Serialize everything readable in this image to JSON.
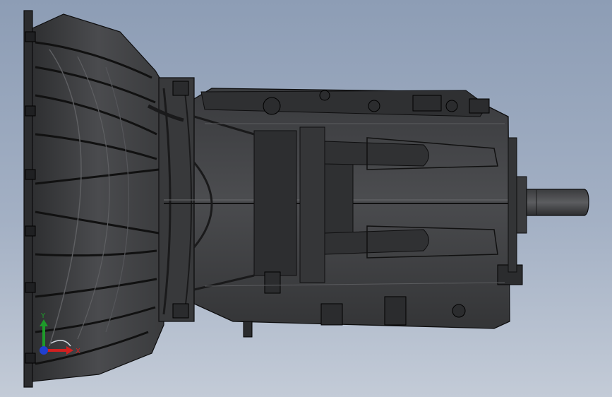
{
  "scene": {
    "colors": {
      "background_top": "#8d9db5",
      "background_bottom": "#c3cbd7",
      "model_fill": "#3f4043",
      "model_dark": "#242527",
      "model_light": "#5a5b5e",
      "edge": "#0e0e0f"
    }
  },
  "triad": {
    "x_label": "X",
    "y_label": "Y",
    "x_color": "#d22020",
    "y_color": "#1e9a2a",
    "z_color": "#2040d0"
  }
}
